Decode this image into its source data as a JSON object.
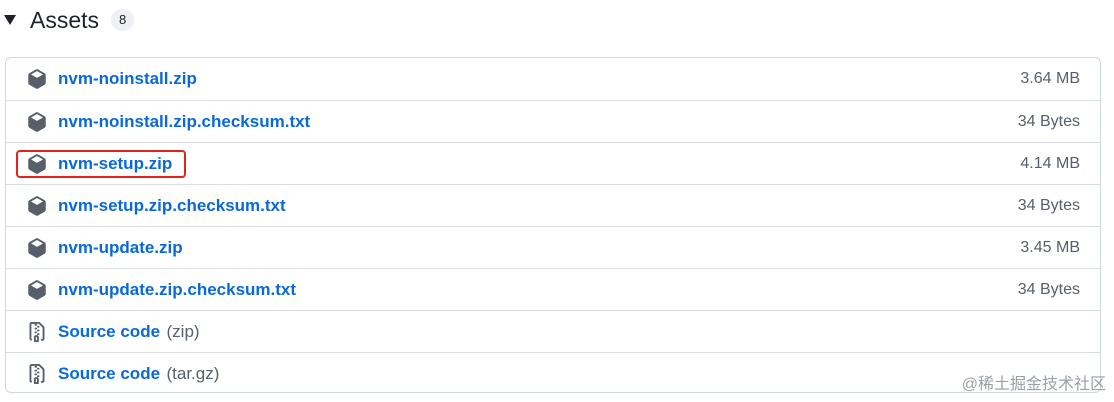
{
  "header": {
    "title": "Assets",
    "count": "8"
  },
  "assets": [
    {
      "name": "nvm-noinstall.zip",
      "size": "3.64 MB",
      "icon": "package-icon"
    },
    {
      "name": "nvm-noinstall.zip.checksum.txt",
      "size": "34 Bytes",
      "icon": "package-icon"
    },
    {
      "name": "nvm-setup.zip",
      "size": "4.14 MB",
      "icon": "package-icon",
      "highlighted": true
    },
    {
      "name": "nvm-setup.zip.checksum.txt",
      "size": "34 Bytes",
      "icon": "package-icon"
    },
    {
      "name": "nvm-update.zip",
      "size": "3.45 MB",
      "icon": "package-icon"
    },
    {
      "name": "nvm-update.zip.checksum.txt",
      "size": "34 Bytes",
      "icon": "package-icon"
    },
    {
      "name": "Source code",
      "suffix": "(zip)",
      "icon": "file-zip-icon"
    },
    {
      "name": "Source code",
      "suffix": "(tar.gz)",
      "icon": "file-zip-icon"
    }
  ],
  "watermark": "@稀土掘金技术社区",
  "colors": {
    "link": "#0969da",
    "muted": "#57606a",
    "highlight": "#e0241b"
  }
}
